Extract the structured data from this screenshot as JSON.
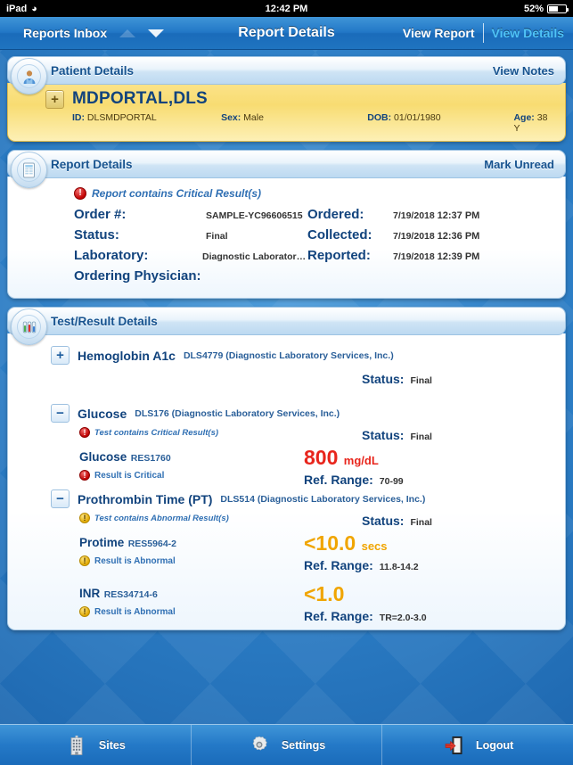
{
  "status_bar": {
    "device": "iPad",
    "wifi_icon": "wifi-icon",
    "time": "12:42 PM",
    "battery_percent": "52%"
  },
  "nav_bar": {
    "back_label": "Reports Inbox",
    "prev_icon": "triangle-up-icon",
    "next_icon": "triangle-down-icon",
    "title": "Report Details",
    "segment_inactive": "View Report",
    "segment_active": "View Details"
  },
  "patient_panel": {
    "icon": "patient-avatar-icon",
    "title": "Patient Details",
    "action": "View Notes",
    "expand_icon": "+",
    "name": "MDPORTAL,DLS",
    "fields": [
      {
        "label": "ID:",
        "value": "DLSMDPORTAL"
      },
      {
        "label": "Sex:",
        "value": "Male"
      },
      {
        "label": "DOB:",
        "value": "01/01/1980"
      },
      {
        "label": "Age:",
        "value": "38 Y"
      }
    ]
  },
  "report_panel": {
    "icon": "report-document-icon",
    "title": "Report Details",
    "action": "Mark Unread",
    "alert_icon": "critical-icon",
    "alert_text": "Report contains Critical Result(s)",
    "left_rows": [
      {
        "label": "Order #:",
        "value": "SAMPLE-YC96606515"
      },
      {
        "label": "Status:",
        "value": "Final"
      },
      {
        "label": "Laboratory:",
        "value": "Diagnostic Laboratory Service..."
      },
      {
        "label": "Ordering Physician:",
        "value": ""
      }
    ],
    "right_rows": [
      {
        "label": "Ordered:",
        "date": "7/19/2018",
        "time": "12:37 PM"
      },
      {
        "label": "Collected:",
        "date": "7/19/2018",
        "time": "12:36 PM"
      },
      {
        "label": "Reported:",
        "date": "7/19/2018",
        "time": "12:39 PM"
      }
    ]
  },
  "tests_panel": {
    "icon": "test-tubes-icon",
    "title": "Test/Result Details",
    "status_label": "Status:",
    "ref_range_label": "Ref. Range:",
    "tests": [
      {
        "toggle_icon": "+",
        "expanded": false,
        "name": "Hemoglobin A1c",
        "code": "DLS4779 (Diagnostic Laboratory Services, Inc.)",
        "flag_text": "",
        "flag_icon": "",
        "status": "Final",
        "results": []
      },
      {
        "toggle_icon": "−",
        "expanded": true,
        "name": "Glucose",
        "code": "DLS176 (Diagnostic Laboratory Services, Inc.)",
        "flag_icon": "critical-icon",
        "flag_text": "Test contains Critical Result(s)",
        "status": "Final",
        "results": [
          {
            "name": "Glucose",
            "code": "RES1760",
            "flag_icon": "critical-icon",
            "flag_text": "Result is Critical",
            "value": "800",
            "unit": "mg/dL",
            "severity": "critical",
            "ref_range": "70-99"
          }
        ]
      },
      {
        "toggle_icon": "−",
        "expanded": true,
        "name": "Prothrombin Time (PT)",
        "code": "DLS514 (Diagnostic Laboratory Services, Inc.)",
        "flag_icon": "abnormal-icon",
        "flag_text": "Test contains Abnormal Result(s)",
        "status": "Final",
        "results": [
          {
            "name": "Protime",
            "code": "RES5964-2",
            "flag_icon": "abnormal-icon",
            "flag_text": "Result is Abnormal",
            "value": "<10.0",
            "unit": "secs",
            "severity": "abnormal",
            "ref_range": "11.8-14.2"
          },
          {
            "name": "INR",
            "code": "RES34714-6",
            "flag_icon": "abnormal-icon",
            "flag_text": "Result is Abnormal",
            "value": "<1.0",
            "unit": "",
            "severity": "abnormal",
            "ref_range": "TR=2.0-3.0"
          }
        ]
      }
    ]
  },
  "tab_bar": {
    "tabs": [
      {
        "icon": "building-icon",
        "label": "Sites"
      },
      {
        "icon": "gear-icon",
        "label": "Settings"
      },
      {
        "icon": "logout-door-icon",
        "label": "Logout"
      }
    ]
  },
  "colors": {
    "critical": "#e8251c",
    "abnormal": "#f0a500",
    "accent_blue": "#11437d",
    "active_segment": "#4fc3f7",
    "patient_banner": "#f8dc72"
  }
}
